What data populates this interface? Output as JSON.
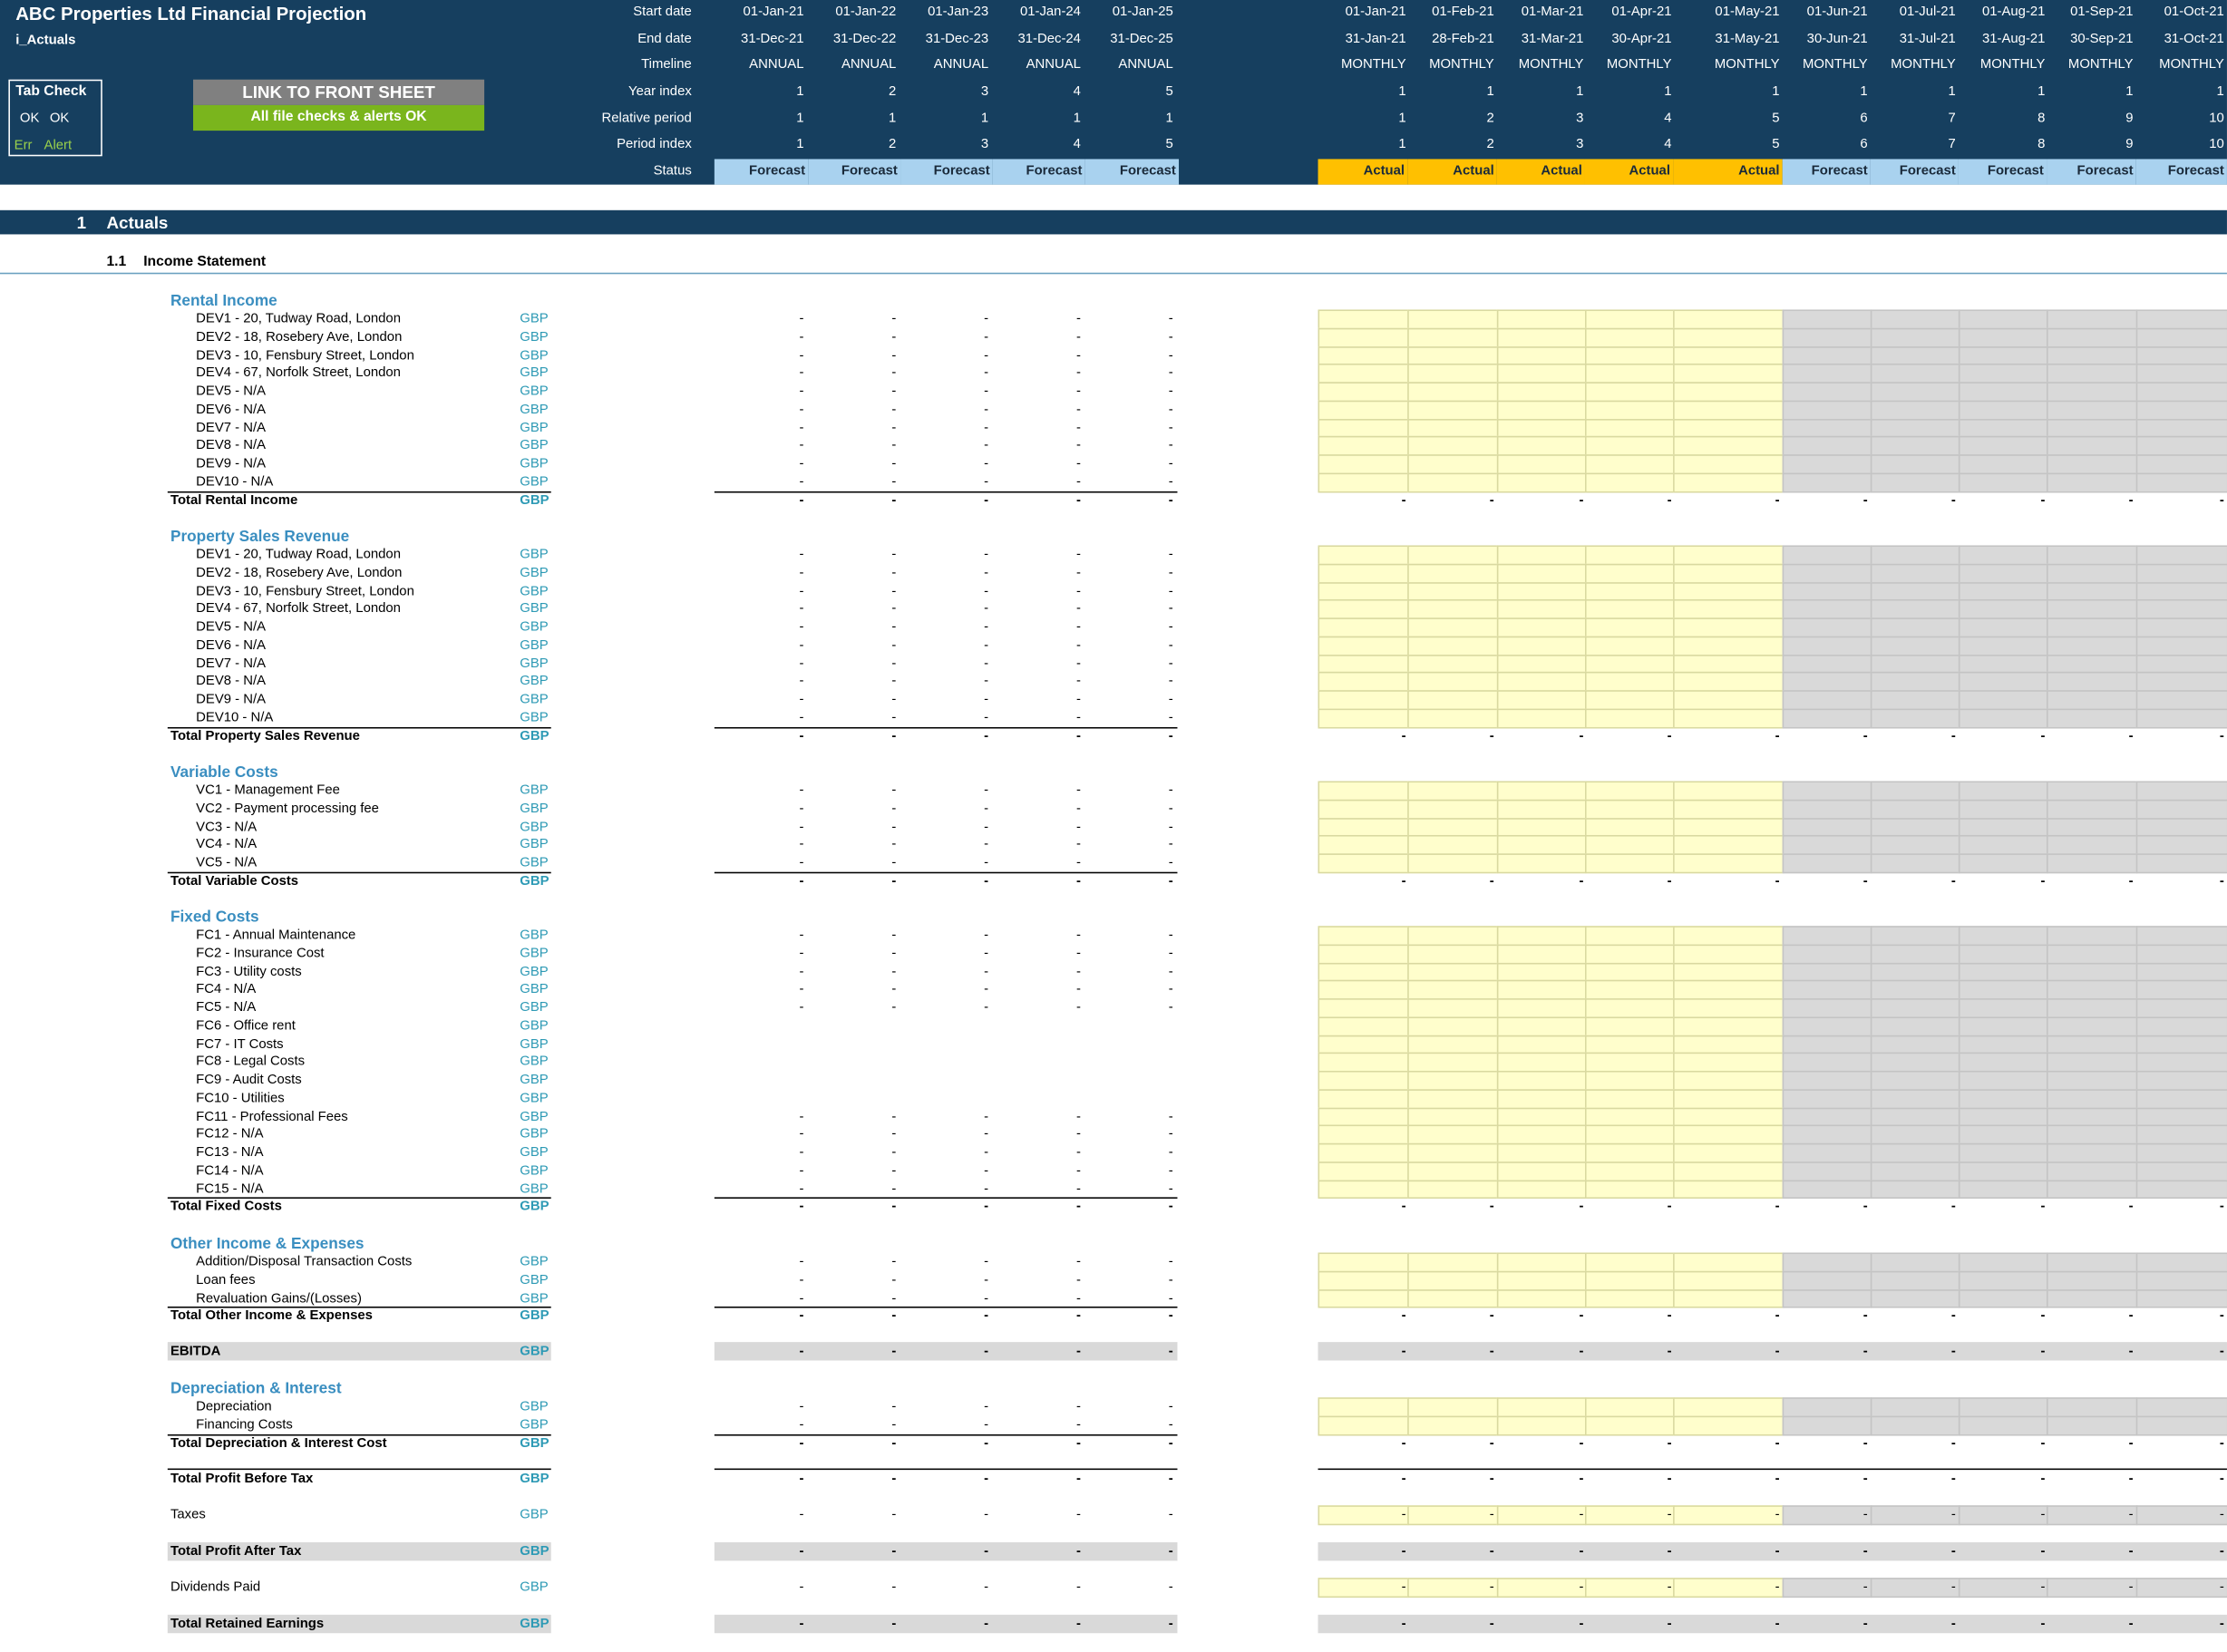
{
  "header": {
    "title": "ABC Properties Ltd Financial Projection",
    "sheet": "i_Actuals",
    "tab_check": {
      "title": "Tab Check",
      "ok1": "OK",
      "ok2": "OK",
      "err": "Err",
      "alert": "Alert"
    },
    "link_button": "LINK TO FRONT SHEET",
    "checks_button": "All file checks & alerts OK",
    "row_labels": [
      "Start date",
      "End date",
      "Timeline",
      "Year index",
      "Relative period",
      "Period index",
      "Status"
    ]
  },
  "annual": {
    "start": [
      "01-Jan-21",
      "01-Jan-22",
      "01-Jan-23",
      "01-Jan-24",
      "01-Jan-25"
    ],
    "end": [
      "31-Dec-21",
      "31-Dec-22",
      "31-Dec-23",
      "31-Dec-24",
      "31-Dec-25"
    ],
    "timeline": [
      "ANNUAL",
      "ANNUAL",
      "ANNUAL",
      "ANNUAL",
      "ANNUAL"
    ],
    "year_index": [
      "1",
      "2",
      "3",
      "4",
      "5"
    ],
    "relative": [
      "1",
      "1",
      "1",
      "1",
      "1"
    ],
    "period_index": [
      "1",
      "2",
      "3",
      "4",
      "5"
    ],
    "status": [
      "Forecast",
      "Forecast",
      "Forecast",
      "Forecast",
      "Forecast"
    ]
  },
  "monthly": {
    "start": [
      "01-Jan-21",
      "01-Feb-21",
      "01-Mar-21",
      "01-Apr-21",
      "01-May-21",
      "01-Jun-21",
      "01-Jul-21",
      "01-Aug-21",
      "01-Sep-21",
      "01-Oct-21"
    ],
    "end": [
      "31-Jan-21",
      "28-Feb-21",
      "31-Mar-21",
      "30-Apr-21",
      "31-May-21",
      "30-Jun-21",
      "31-Jul-21",
      "31-Aug-21",
      "30-Sep-21",
      "31-Oct-21"
    ],
    "timeline": [
      "MONTHLY",
      "MONTHLY",
      "MONTHLY",
      "MONTHLY",
      "MONTHLY",
      "MONTHLY",
      "MONTHLY",
      "MONTHLY",
      "MONTHLY",
      "MONTHLY"
    ],
    "year_index": [
      "1",
      "1",
      "1",
      "1",
      "1",
      "1",
      "1",
      "1",
      "1",
      "1"
    ],
    "relative": [
      "1",
      "2",
      "3",
      "4",
      "5",
      "6",
      "7",
      "8",
      "9",
      "10"
    ],
    "period_index": [
      "1",
      "2",
      "3",
      "4",
      "5",
      "6",
      "7",
      "8",
      "9",
      "10"
    ],
    "status": [
      "Actual",
      "Actual",
      "Actual",
      "Actual",
      "Actual",
      "Forecast",
      "Forecast",
      "Forecast",
      "Forecast",
      "Forecast"
    ]
  },
  "section": {
    "num": "1",
    "title": "Actuals",
    "sub_num": "1.1",
    "sub_title": "Income Statement"
  },
  "unit": "GBP",
  "dash": "-",
  "groups": [
    {
      "title": "Rental Income",
      "items": [
        "DEV1 - 20, Tudway Road, London",
        "DEV2 - 18, Rosebery Ave, London",
        "DEV3 - 10, Fensbury Street, London",
        "DEV4 - 67, Norfolk Street, London",
        "DEV5 - N/A",
        "DEV6 - N/A",
        "DEV7 - N/A",
        "DEV8 - N/A",
        "DEV9 - N/A",
        "DEV10 - N/A"
      ],
      "total": "Total Rental Income"
    },
    {
      "title": "Property Sales Revenue",
      "items": [
        "DEV1 - 20, Tudway Road, London",
        "DEV2 - 18, Rosebery Ave, London",
        "DEV3 - 10, Fensbury Street, London",
        "DEV4 - 67, Norfolk Street, London",
        "DEV5 - N/A",
        "DEV6 - N/A",
        "DEV7 - N/A",
        "DEV8 - N/A",
        "DEV9 - N/A",
        "DEV10 - N/A"
      ],
      "total": "Total Property Sales Revenue"
    },
    {
      "title": "Variable Costs",
      "items": [
        "VC1 - Management Fee",
        "VC2 - Payment processing fee",
        "VC3 - N/A",
        "VC4 - N/A",
        "VC5 - N/A"
      ],
      "total": "Total Variable Costs"
    },
    {
      "title": "Fixed Costs",
      "items": [
        "FC1 - Annual Maintenance",
        "FC2 - Insurance Cost",
        "FC3 - Utility costs",
        "FC4 - N/A",
        "FC5 - N/A",
        "FC6 - Office rent",
        "FC7 - IT Costs",
        "FC8 - Legal Costs",
        "FC9 - Audit Costs",
        "FC10 - Utilities",
        "FC11 - Professional Fees",
        "FC12 - N/A",
        "FC13 - N/A",
        "FC14 - N/A",
        "FC15 - N/A"
      ],
      "total": "Total Fixed Costs"
    },
    {
      "title": "Other Income & Expenses",
      "items": [
        "Addition/Disposal Transaction Costs",
        "Loan fees",
        "Revaluation Gains/(Losses)"
      ],
      "total": "Total Other Income & Expenses"
    },
    {
      "title": "Depreciation & Interest",
      "items": [
        "Depreciation",
        "Financing Costs"
      ],
      "total": "Total Depreciation & Interest Cost"
    }
  ],
  "ebitda": "EBITDA",
  "profit_before_tax": "Total Profit Before Tax",
  "taxes": "Taxes",
  "profit_after_tax": "Total Profit After Tax",
  "dividends": "Dividends Paid",
  "retained": "Total Retained Earnings",
  "colors": {
    "header_bg": "#163f5f",
    "forecast": "#a9d2ef",
    "actual": "#ffc000",
    "input": "#fffecc",
    "green": "#7ab51d",
    "group_title": "#3a8ec0",
    "unit": "#2e9ab5"
  }
}
